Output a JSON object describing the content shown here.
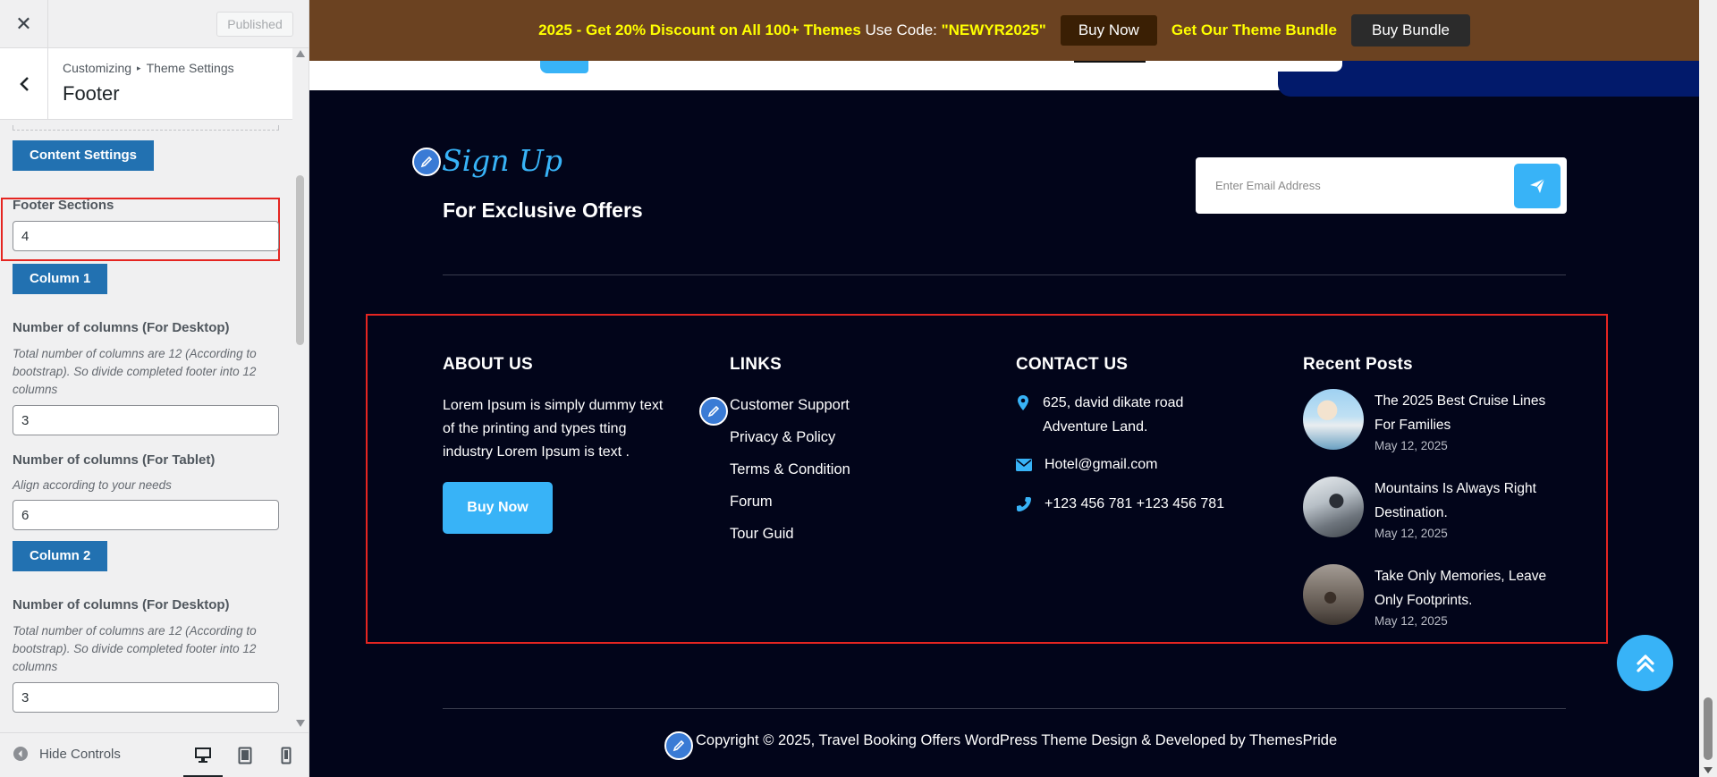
{
  "customizer": {
    "header": {
      "close_icon": "close-icon",
      "published_label": "Published"
    },
    "section": {
      "crumb_parent": "Customizing",
      "crumb_child": "Theme Settings",
      "title": "Footer"
    },
    "controls": {
      "content_settings_label": "Content Settings",
      "footer_sections_label": "Footer Sections",
      "footer_sections_value": "4",
      "column1_label": "Column 1",
      "desktop_cols_label": "Number of columns (For Desktop)",
      "desktop_cols_desc": "Total number of columns are 12 (According to bootstrap). So divide completed footer into 12 columns",
      "col1_desktop_value": "3",
      "tablet_cols_label": "Number of columns (For Tablet)",
      "tablet_cols_desc": "Align according to your needs",
      "col1_tablet_value": "6",
      "column2_label": "Column 2",
      "col2_desktop_label": "Number of columns (For Desktop)",
      "col2_desktop_desc": "Total number of columns are 12 (According to bootstrap). So divide completed footer into 12 columns",
      "col2_desktop_value": "3"
    },
    "footer": {
      "hide_controls_label": "Hide Controls"
    }
  },
  "promo": {
    "highlight_text": "2025 - Get 20% Discount on All 100+ Themes",
    "use_code_text": " Use Code: ",
    "code": "\"NEWYR2025\"",
    "buy_now_label": "Buy Now",
    "bundle_text": "Get Our Theme Bundle",
    "buy_bundle_label": "Buy Bundle"
  },
  "signup": {
    "script_title": "Sign Up",
    "subtitle": "For Exclusive Offers",
    "email_placeholder": "Enter Email Address"
  },
  "footer": {
    "about": {
      "title": "ABOUT US",
      "text": "Lorem Ipsum is simply dummy text of the printing and types tting industry Lorem Ipsum is text .",
      "button_label": "Buy Now"
    },
    "links": {
      "title": "LINKS",
      "items": [
        "Customer Support",
        "Privacy & Policy",
        "Terms & Condition",
        "Forum",
        "Tour Guid"
      ]
    },
    "contact": {
      "title": "CONTACT US",
      "address": "625, david dikate road Adventure Land.",
      "email": "Hotel@gmail.com",
      "phone": "+123 456 781 +123 456 781"
    },
    "recent": {
      "title": "Recent Posts",
      "posts": [
        {
          "title": "The 2025 Best Cruise Lines For Families",
          "date": "May 12, 2025"
        },
        {
          "title": "Mountains Is Always Right Destination.",
          "date": "May 12, 2025"
        },
        {
          "title": "Take Only Memories, Leave Only Footprints.",
          "date": "May 12, 2025"
        }
      ]
    },
    "copyright": "Copyright © 2025, Travel Booking Offers WordPress Theme Design & Developed by ThemesPride"
  },
  "colors": {
    "accent": "#38b3f7",
    "footer_bg": "#02051a",
    "promo_bg": "#6b4221",
    "highlight": "#e52521",
    "wp_blue": "#2271b1"
  }
}
